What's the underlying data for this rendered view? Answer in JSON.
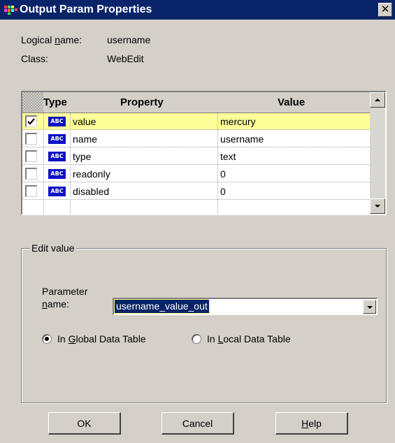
{
  "window": {
    "title": "Output Param Properties",
    "close_glyph": "✕"
  },
  "info": {
    "logical_name_label_pre": "Logical ",
    "logical_name_label_ul": "n",
    "logical_name_label_post": "ame:",
    "logical_name_value": "username",
    "class_label": "Class:",
    "class_value": "WebEdit"
  },
  "grid": {
    "headers": {
      "type": "Type",
      "property": "Property",
      "value": "Value"
    },
    "type_badge": "ABC",
    "rows": [
      {
        "checked": true,
        "property": "value",
        "value": "mercury",
        "selected": true
      },
      {
        "checked": false,
        "property": "name",
        "value": "username",
        "selected": false
      },
      {
        "checked": false,
        "property": "type",
        "value": "text",
        "selected": false
      },
      {
        "checked": false,
        "property": "readonly",
        "value": "0",
        "selected": false
      },
      {
        "checked": false,
        "property": "disabled",
        "value": "0",
        "selected": false
      }
    ]
  },
  "edit_value": {
    "legend": "Edit value",
    "param_label_line1": "Parameter",
    "param_label_ul": "n",
    "param_label_line2_rest": "ame:",
    "param_value": "username_value_out",
    "radio_global_pre": "In ",
    "radio_global_ul": "G",
    "radio_global_post": "lobal Data Table",
    "radio_local_pre": "In ",
    "radio_local_ul": "L",
    "radio_local_post": "ocal Data Table",
    "selected_radio": "global"
  },
  "buttons": {
    "ok": "OK",
    "cancel": "Cancel",
    "help_ul": "H",
    "help_rest": "elp"
  },
  "colors": {
    "titlebar": "#0a246a",
    "selected_row": "#ffff99",
    "type_badge": "#1010c8",
    "face": "#d4d0c8"
  },
  "icons": {
    "app": "multicolor-app-icon",
    "close": "close-icon",
    "scroll_up": "arrow-up-icon",
    "scroll_down": "arrow-down-icon",
    "dropdown": "chevron-down-icon",
    "check": "checkmark-icon"
  }
}
